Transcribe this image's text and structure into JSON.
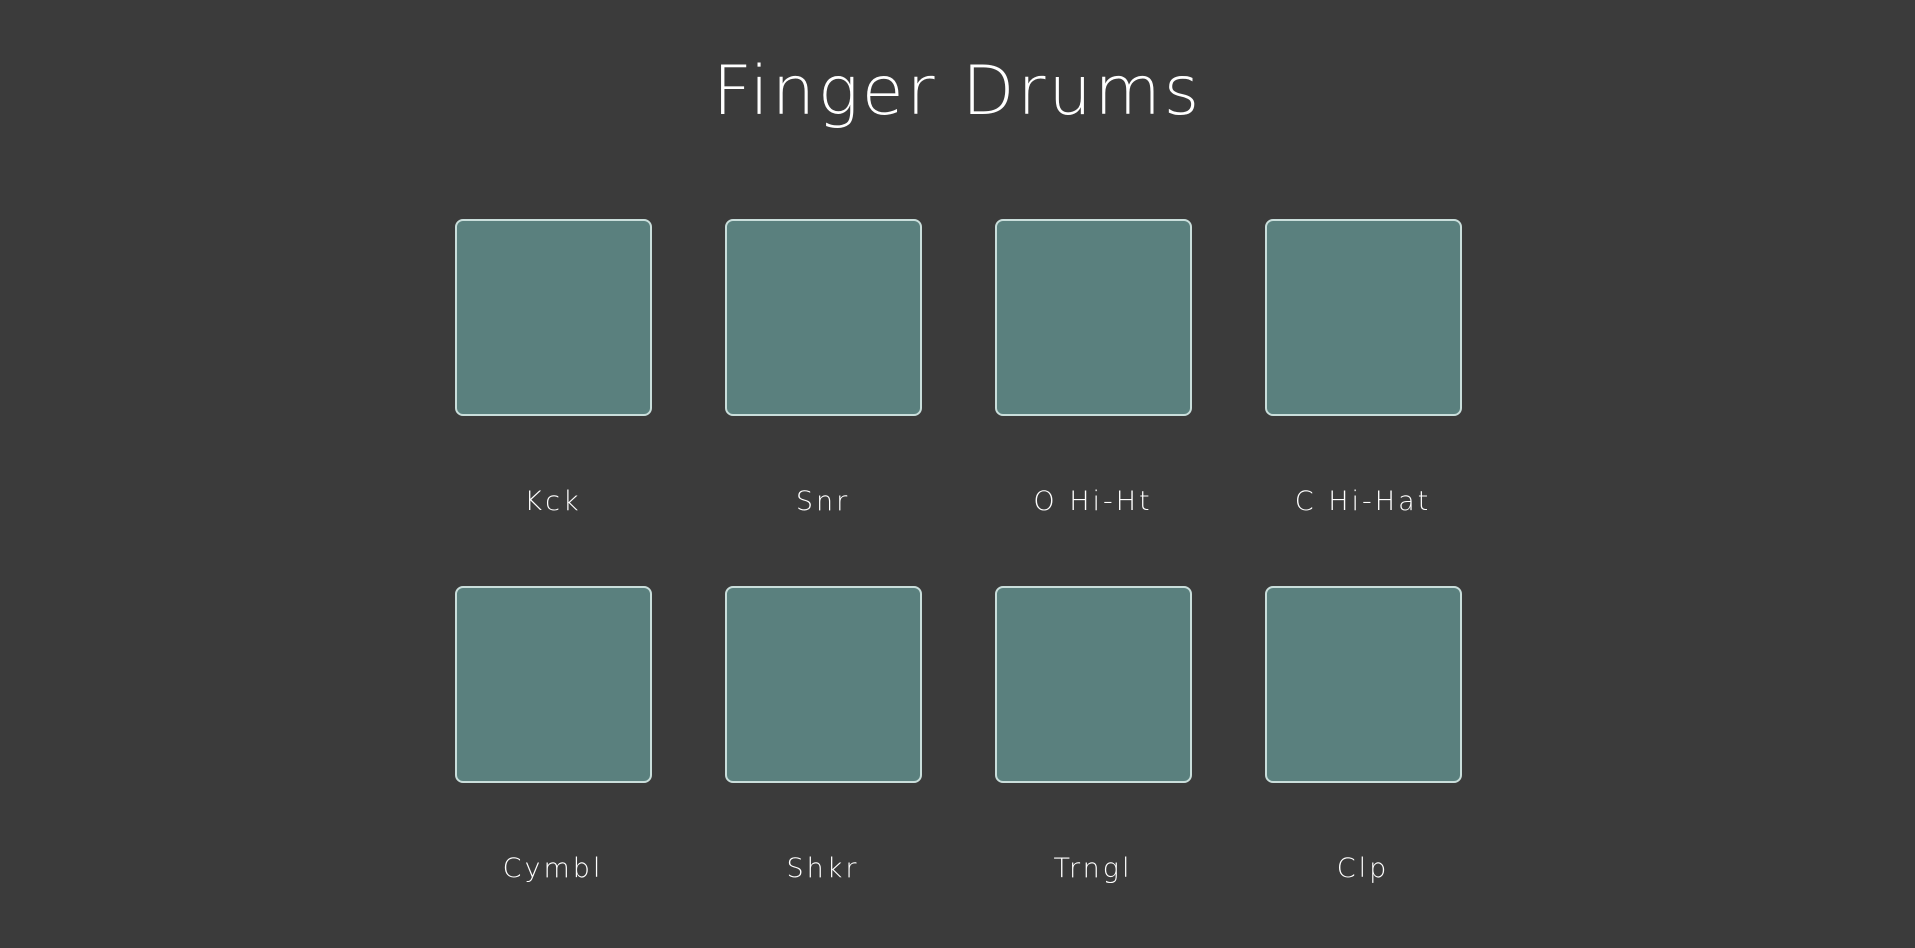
{
  "title": "Finger Drums",
  "colors": {
    "background": "#3b3b3b",
    "pad_fill": "#5a807e",
    "pad_border": "#c9dedb",
    "text": "#ffffff"
  },
  "pads": [
    {
      "label": "Kck"
    },
    {
      "label": "Snr"
    },
    {
      "label": "O Hi-Ht"
    },
    {
      "label": "C Hi-Hat"
    },
    {
      "label": "Cymbl"
    },
    {
      "label": "Shkr"
    },
    {
      "label": "Trngl"
    },
    {
      "label": "Clp"
    }
  ]
}
